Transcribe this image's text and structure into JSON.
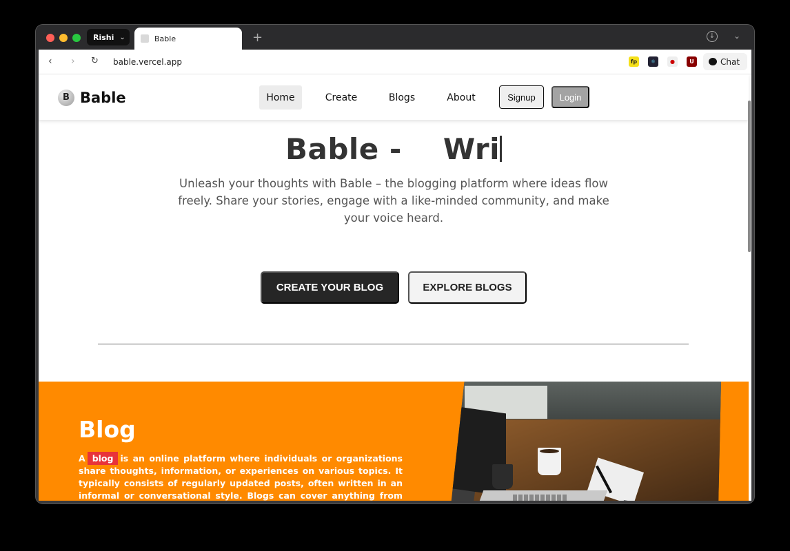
{
  "browser": {
    "profile_name": "Rishi",
    "tab_title": "Bable",
    "url": "bable.vercel.app",
    "chat_label": "Chat",
    "extensions": [
      "fp",
      "react-devtools",
      "korean",
      "ublock"
    ]
  },
  "site": {
    "logo_letter": "B",
    "brand": "Bable",
    "nav": {
      "home": "Home",
      "create": "Create",
      "blogs": "Blogs",
      "about": "About",
      "signup": "Signup",
      "login": "Login"
    }
  },
  "hero": {
    "title_prefix": "Bable -",
    "title_typed": "Wri",
    "description": "Unleash your thoughts with Bable – the blogging platform where ideas flow freely. Share your stories, engage with a like-minded community, and make your voice heard.",
    "primary_cta": "CREATE YOUR BLOG",
    "secondary_cta": "EXPLORE BLOGS"
  },
  "blog_section": {
    "title": "Blog",
    "text_start": "A",
    "highlight": "blog",
    "text_rest": "is an online platform where individuals or organizations share thoughts, information, or experiences on various topics. It typically consists of regularly updated posts, often written in an informal or conversational style. Blogs can cover anything from personal stories to professional insights, helping engage audiences and share knowledge.",
    "accent_color": "#ff8a00",
    "highlight_color": "#e8333a"
  }
}
